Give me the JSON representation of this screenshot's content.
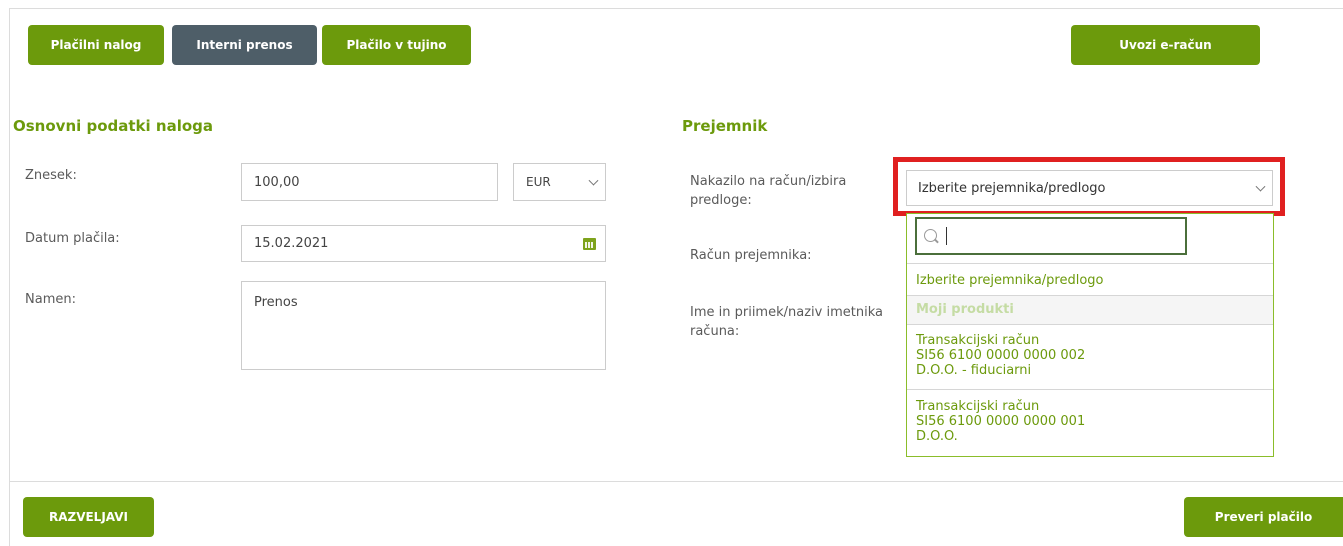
{
  "tabs": {
    "domestic_payment": "Plačilni nalog",
    "internal_transfer": "Interni prenos",
    "foreign_payment": "Plačilo v tujino"
  },
  "import_einvoice": "Uvozi e-račun",
  "basic": {
    "title": "Osnovni podatki naloga",
    "amount_label": "Znesek:",
    "amount_value": "100,00",
    "currency_value": "EUR",
    "date_label": "Datum plačila:",
    "date_value": "15.02.2021",
    "purpose_label": "Namen:",
    "purpose_value": "Prenos"
  },
  "recipient": {
    "title": "Prejemnik",
    "transfer_label": "Nakazilo na račun/izbira predloge:",
    "select_value": "Izberite prejemnika/predlogo",
    "account_label": "Račun prejemnika:",
    "holder_label": "Ime in priimek/naziv imetnika računa:"
  },
  "dropdown": {
    "search_value": "",
    "placeholder_option": "Izberite prejemnika/predlogo",
    "group_label": "Moji produkti",
    "options": [
      {
        "type": "Transakcijski račun",
        "iban": "SI56 6100 0000 0000 002",
        "holder": "D.O.O. - fiduciarni"
      },
      {
        "type": "Transakcijski račun",
        "iban": "SI56 6100 0000 0000 001",
        "holder": "D.O.O."
      }
    ]
  },
  "footer": {
    "undo": "RAZVELJAVI",
    "check_payment": "Preveri plačilo"
  },
  "colors": {
    "accent": "#6c9a0c",
    "active_tab": "#4e5e68",
    "highlight": "#e02020"
  }
}
